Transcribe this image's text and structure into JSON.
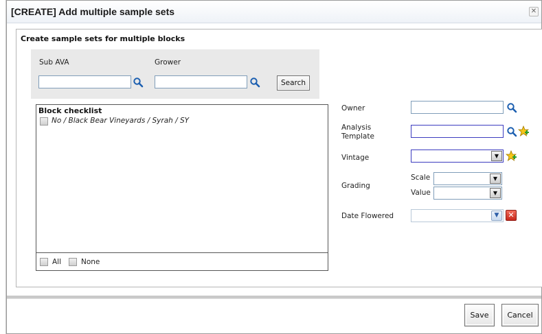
{
  "dialog": {
    "title": "[CREATE] Add multiple sample sets",
    "close_icon": "close-icon"
  },
  "section": {
    "title": "Create sample sets for multiple blocks"
  },
  "filters": {
    "sub_ava_label": "Sub AVA",
    "sub_ava_value": "",
    "grower_label": "Grower",
    "grower_value": "",
    "search_label": "Search"
  },
  "block_checklist": {
    "title": "Block checklist",
    "items": [
      {
        "label": "No / Black Bear Vineyards / Syrah / SY",
        "checked": false
      }
    ],
    "all_label": "All",
    "none_label": "None"
  },
  "form": {
    "owner_label": "Owner",
    "owner_value": "",
    "analysis_template_label_1": "Analysis",
    "analysis_template_label_2": "Template",
    "analysis_template_value": "",
    "vintage_label": "Vintage",
    "vintage_value": "",
    "grading_label": "Grading",
    "scale_label": "Scale",
    "scale_value": "",
    "value_label": "Value",
    "value_value": "",
    "date_flowered_label": "Date Flowered",
    "date_flowered_value": ""
  },
  "footer": {
    "save_label": "Save",
    "cancel_label": "Cancel"
  },
  "colors": {
    "input_border": "#7f9db9",
    "filter_bg": "#e9e9e9",
    "search_icon_color": "#1c5fb0",
    "add_icon_color": "#e8b400",
    "clear_icon_color": "#d23a2a"
  }
}
